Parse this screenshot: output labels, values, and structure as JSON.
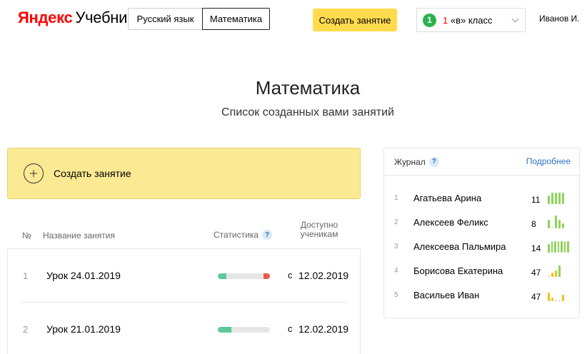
{
  "header": {
    "logo_brand": "Яндекс",
    "logo_product": "Учебник",
    "subject_tabs": [
      "Русский язык",
      "Математика"
    ],
    "create_button": "Создать занятие",
    "class_select": {
      "badge": "1",
      "num": "1",
      "label": " «в» класс"
    },
    "user": "Иванов И."
  },
  "main": {
    "title": "Математика",
    "subtitle": "Список созданных вами занятий",
    "create_card_label": "Создать занятие",
    "table": {
      "col_num": "№",
      "col_name": "Название занятия",
      "col_stats": "Статистика",
      "col_stats_help": "?",
      "col_available_1": "Доступно",
      "col_available_2": "ученикам"
    },
    "lessons": [
      {
        "num": "1",
        "name": "Урок 24.01.2019",
        "from": "с",
        "date": "12.02.2019",
        "progress_correct": 0.16,
        "progress_wrong": 0.12
      },
      {
        "num": "2",
        "name": "Урок 21.01.2019",
        "from": "с",
        "date": "12.02.2019",
        "progress_correct": 0.26,
        "progress_wrong": 0
      }
    ]
  },
  "journal": {
    "title": "Журнал",
    "help": "?",
    "more": "Подробнее",
    "colors": {
      "green": "#8ed45a",
      "yellow": "#f2c318",
      "grey": "#d8d8d8"
    },
    "students": [
      {
        "num": "1",
        "name": "Агатьева Арина",
        "score": "11",
        "bars": [
          {
            "h": 0.6,
            "c": "green"
          },
          {
            "h": 0.8,
            "c": "green"
          },
          {
            "h": 0.8,
            "c": "green"
          },
          {
            "h": 0.8,
            "c": "green"
          },
          {
            "h": 0.8,
            "c": "green"
          }
        ]
      },
      {
        "num": "2",
        "name": "Алексеев Феликс",
        "score": "8",
        "bars": [
          {
            "h": 0.6,
            "c": "green"
          },
          {
            "h": 0.1,
            "c": "grey"
          },
          {
            "h": 0.9,
            "c": "green"
          },
          {
            "h": 0.6,
            "c": "green"
          },
          {
            "h": 0.35,
            "c": "green"
          }
        ]
      },
      {
        "num": "3",
        "name": "Алексеева Пальмира",
        "score": "14",
        "bars": [
          {
            "h": 0.6,
            "c": "green"
          },
          {
            "h": 0.8,
            "c": "green"
          },
          {
            "h": 0.8,
            "c": "green"
          },
          {
            "h": 0.8,
            "c": "green"
          },
          {
            "h": 0.8,
            "c": "green"
          },
          {
            "h": 0.8,
            "c": "green"
          },
          {
            "h": 0.8,
            "c": "green"
          }
        ]
      },
      {
        "num": "4",
        "name": "Борисова Екатерина",
        "score": "47",
        "bars": [
          {
            "h": 0.1,
            "c": "grey"
          },
          {
            "h": 0.3,
            "c": "yellow"
          },
          {
            "h": 0.45,
            "c": "yellow"
          },
          {
            "h": 0.8,
            "c": "green"
          }
        ]
      },
      {
        "num": "5",
        "name": "Васильев Иван",
        "score": "47",
        "bars": [
          {
            "h": 0.6,
            "c": "yellow"
          },
          {
            "h": 0.25,
            "c": "yellow"
          },
          {
            "h": 0.1,
            "c": "grey"
          },
          {
            "h": 0.1,
            "c": "grey"
          },
          {
            "h": 0.45,
            "c": "yellow"
          }
        ]
      }
    ]
  }
}
